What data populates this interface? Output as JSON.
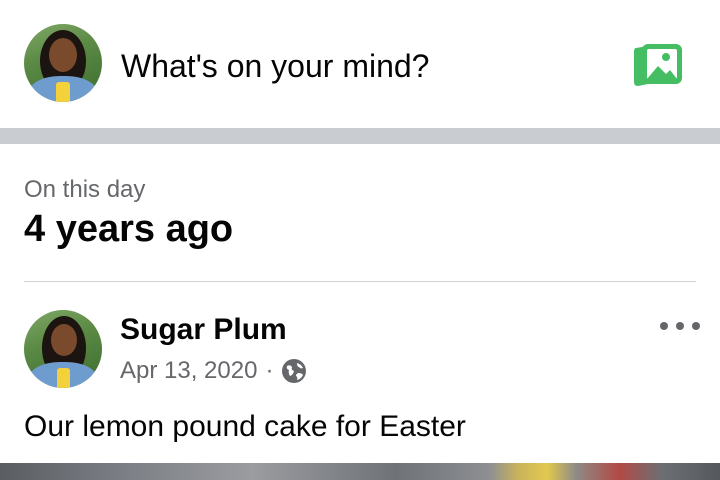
{
  "composer": {
    "prompt": "What's on your mind?",
    "photo_icon": "photo-gallery-icon",
    "photo_icon_color": "#45bd62"
  },
  "memory": {
    "label": "On this day",
    "title": "4 years ago"
  },
  "post": {
    "author": "Sugar Plum",
    "date": "Apr 13, 2020",
    "separator": "·",
    "privacy_icon": "globe-icon",
    "text": "Our lemon pound cake for Easter",
    "more_icon": "more-options-icon"
  },
  "colors": {
    "divider": "#c9ccd1",
    "secondary_text": "#65676b",
    "primary_text": "#050505"
  }
}
